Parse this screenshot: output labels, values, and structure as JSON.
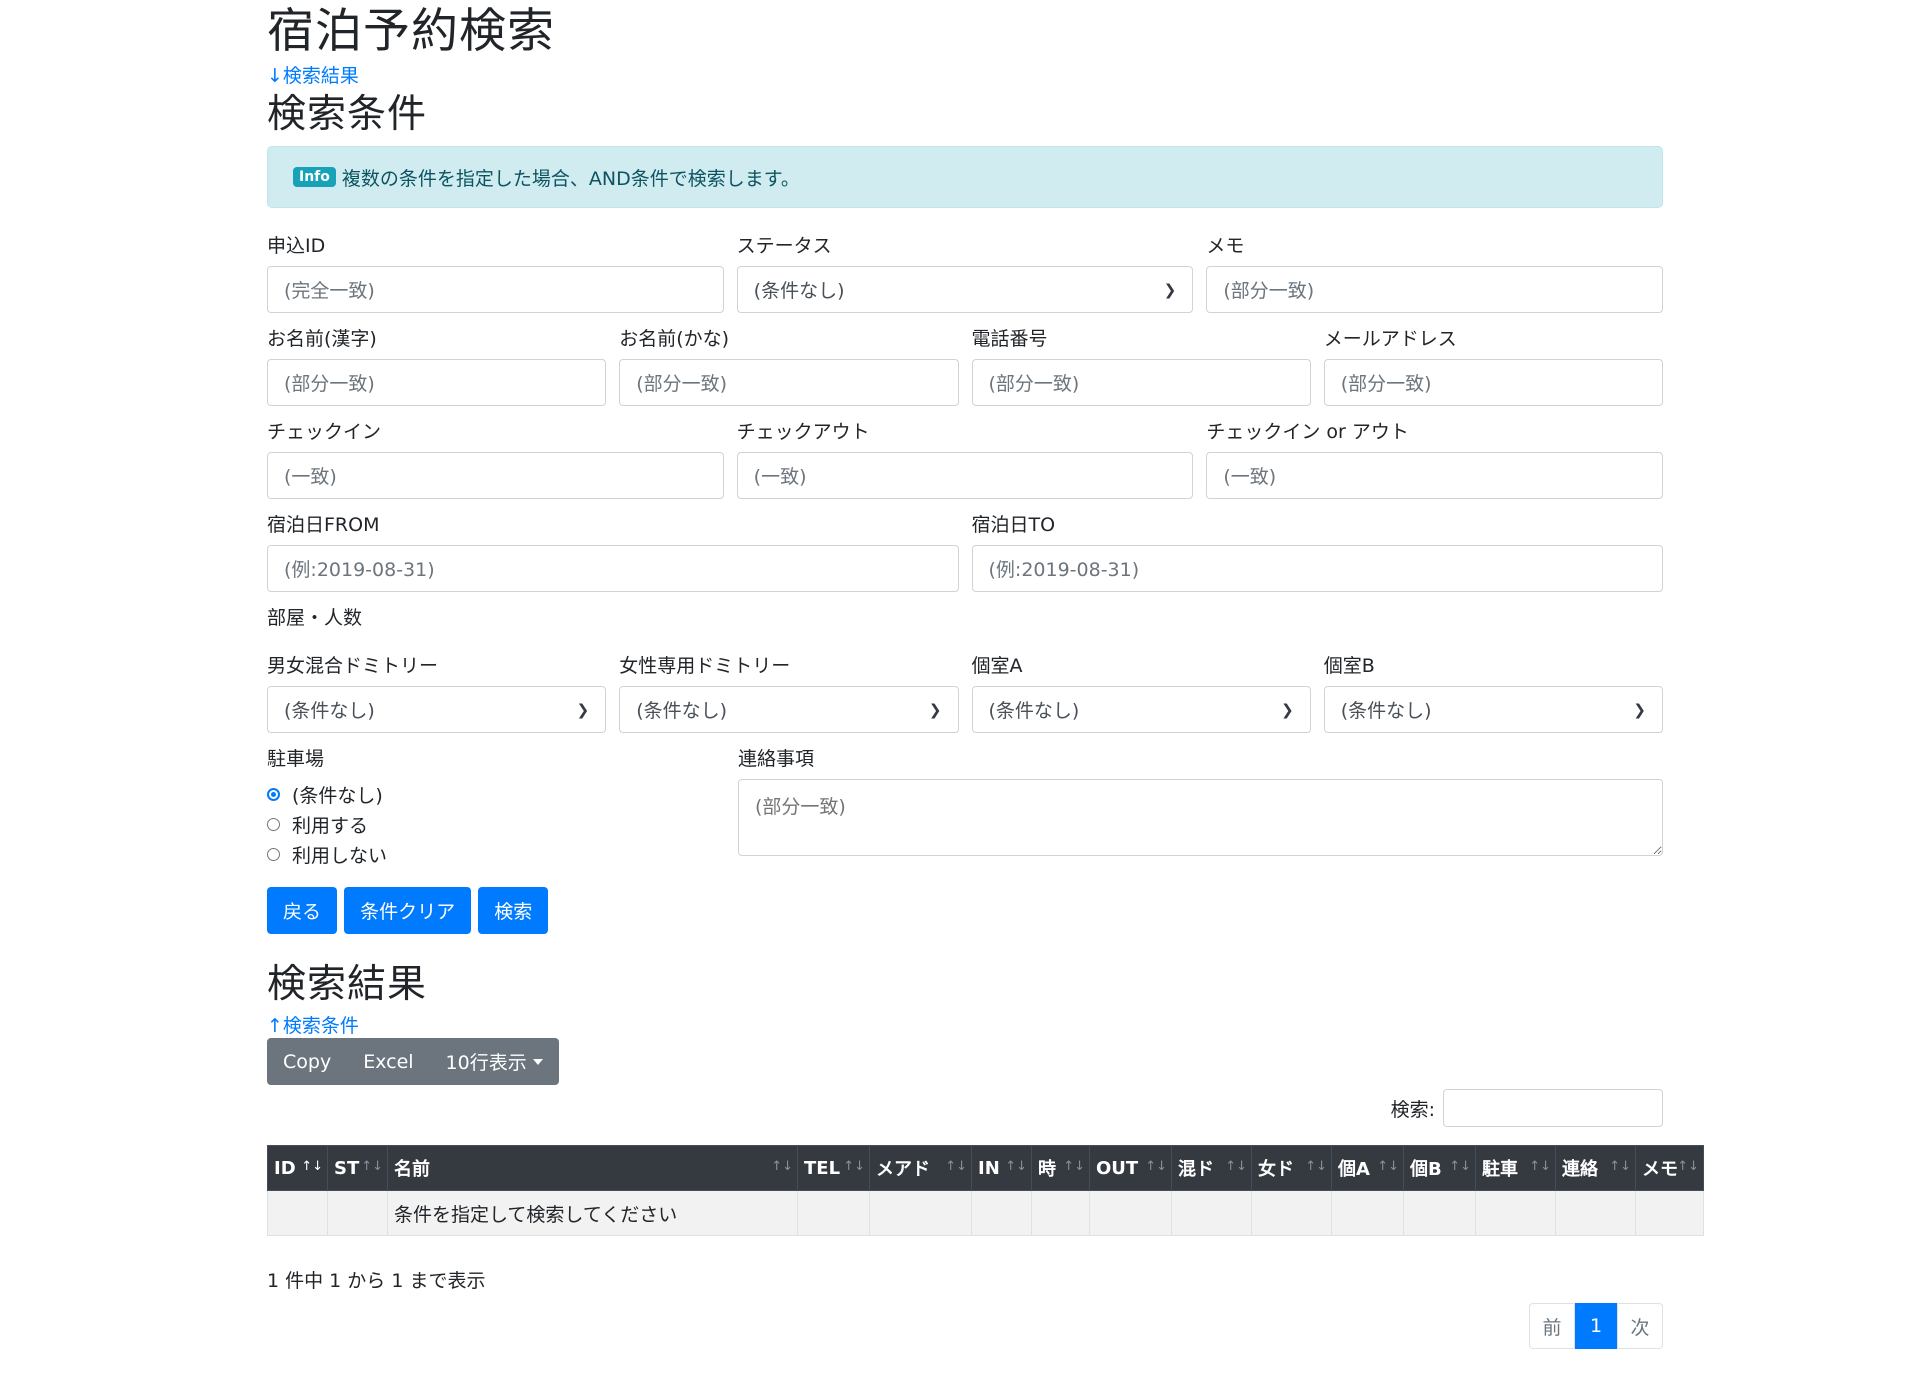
{
  "page_title": "宿泊予約検索",
  "to_results_link": "↓検索結果",
  "conditions_heading": "検索条件",
  "alert": {
    "badge": "Info",
    "text": "複数の条件を指定した場合、AND条件で検索します。"
  },
  "fields": {
    "application_id": {
      "label": "申込ID",
      "placeholder": "(完全一致)"
    },
    "status": {
      "label": "ステータス",
      "value": "(条件なし)"
    },
    "memo": {
      "label": "メモ",
      "placeholder": "(部分一致)"
    },
    "name_kanji": {
      "label": "お名前(漢字)",
      "placeholder": "(部分一致)"
    },
    "name_kana": {
      "label": "お名前(かな)",
      "placeholder": "(部分一致)"
    },
    "phone": {
      "label": "電話番号",
      "placeholder": "(部分一致)"
    },
    "email": {
      "label": "メールアドレス",
      "placeholder": "(部分一致)"
    },
    "checkin": {
      "label": "チェックイン",
      "placeholder": "(一致)"
    },
    "checkout": {
      "label": "チェックアウト",
      "placeholder": "(一致)"
    },
    "checkin_or_out": {
      "label": "チェックイン or アウト",
      "placeholder": "(一致)"
    },
    "stay_from": {
      "label": "宿泊日FROM",
      "placeholder": "(例:2019-08-31)"
    },
    "stay_to": {
      "label": "宿泊日TO",
      "placeholder": "(例:2019-08-31)"
    },
    "rooms_heading": "部屋・人数",
    "mixed_dorm": {
      "label": "男女混合ドミトリー",
      "value": "(条件なし)"
    },
    "female_dorm": {
      "label": "女性専用ドミトリー",
      "value": "(条件なし)"
    },
    "private_a": {
      "label": "個室A",
      "value": "(条件なし)"
    },
    "private_b": {
      "label": "個室B",
      "value": "(条件なし)"
    },
    "parking": {
      "label": "駐車場",
      "options": [
        "(条件なし)",
        "利用する",
        "利用しない"
      ],
      "selected": "(条件なし)"
    },
    "contact": {
      "label": "連絡事項",
      "placeholder": "(部分一致)"
    }
  },
  "buttons": {
    "back": "戻る",
    "clear": "条件クリア",
    "search": "検索"
  },
  "results_heading": "検索結果",
  "to_conditions_link": "↑検索条件",
  "export": {
    "copy": "Copy",
    "excel": "Excel",
    "rows": "10行表示"
  },
  "table_search_label": "検索:",
  "table": {
    "columns": [
      "ID",
      "ST",
      "名前",
      "TEL",
      "メアド",
      "IN",
      "時",
      "OUT",
      "混ド",
      "女ド",
      "個A",
      "個B",
      "駐車",
      "連絡",
      "メモ"
    ],
    "empty_message": "条件を指定して検索してください"
  },
  "table_info": "1 件中 1 から 1 まで表示",
  "pagination": {
    "prev": "前",
    "page": "1",
    "next": "次"
  },
  "colors": {
    "primary": "#007bff",
    "secondary": "#6c757d",
    "dark": "#343a40",
    "info_bg": "#d1ecf1"
  }
}
